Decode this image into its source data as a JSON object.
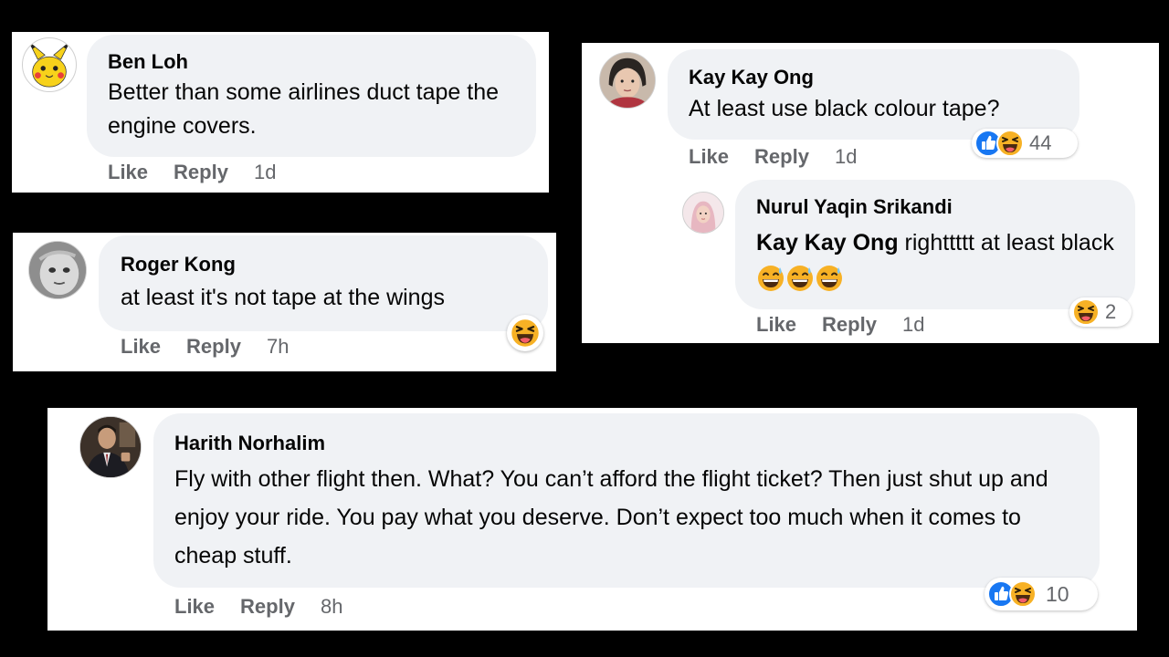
{
  "comments": [
    {
      "name": "Ben Loh",
      "text": "Better than some airlines duct tape the engine covers.",
      "actions": {
        "like": "Like",
        "reply": "Reply",
        "time": "1d"
      }
    },
    {
      "name": "Roger Kong",
      "text": "at least it's not tape at the wings",
      "actions": {
        "like": "Like",
        "reply": "Reply",
        "time": "7h"
      }
    },
    {
      "name": "Kay Kay Ong",
      "text": "At least use black colour tape?",
      "reaction_count": "44",
      "actions": {
        "like": "Like",
        "reply": "Reply",
        "time": "1d"
      }
    },
    {
      "name": "Nurul Yaqin Srikandi",
      "mention": "Kay Kay Ong",
      "text": " righttttt at least black ",
      "reaction_count": "2",
      "actions": {
        "like": "Like",
        "reply": "Reply",
        "time": "1d"
      }
    },
    {
      "name": "Harith Norhalim",
      "text": "Fly with other flight then. What? You can’t afford the flight ticket? Then just shut up and enjoy your ride. You pay what you deserve. Don’t expect too much when it comes to cheap stuff.",
      "reaction_count": "10",
      "actions": {
        "like": "Like",
        "reply": "Reply",
        "time": "8h"
      }
    }
  ],
  "colors": {
    "background": "#000000",
    "card": "#ffffff",
    "bubble": "#f0f2f5",
    "meta_text": "#65676b",
    "like_blue": "#1877f2",
    "haha_yellow": "#f7b125"
  },
  "icons": [
    "pikachu-avatar",
    "baby-avatar",
    "woman-avatar",
    "hijab-avatar",
    "man-suit-avatar",
    "like-icon",
    "haha-icon",
    "sweat-smile-emoji"
  ]
}
